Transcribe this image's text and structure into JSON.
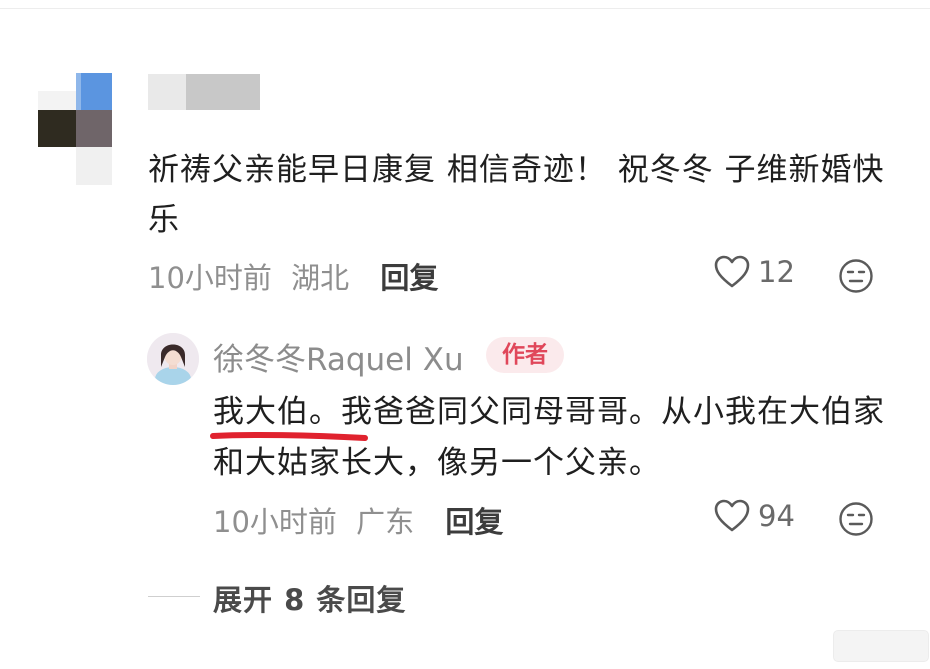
{
  "comment": {
    "text": "祈祷父亲能早日康复 相信奇迹！ 祝冬冬 子维新婚快乐",
    "time": "10小时前",
    "location": "湖北",
    "reply_label": "回复",
    "likes": "12"
  },
  "reply": {
    "username": "徐冬冬Raquel Xu",
    "badge": "作者",
    "text": "我大伯。我爸爸同父同母哥哥。从小我在大伯家和大姑家长大，像另一个父亲。",
    "time": "10小时前",
    "location": "广东",
    "reply_label": "回复",
    "likes": "94"
  },
  "expand_replies": "展开 8 条回复",
  "colors": {
    "badge_text": "#e0475a",
    "badge_bg": "#fbeaec",
    "underline_mark": "#e0222e"
  }
}
